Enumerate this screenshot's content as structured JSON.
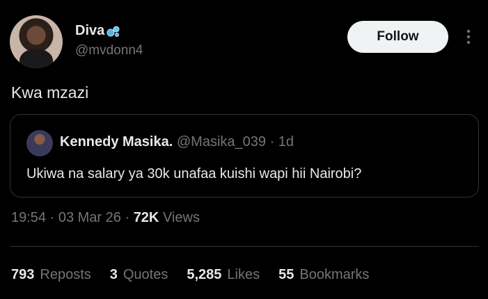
{
  "author": {
    "display_name": "Diva",
    "handle": "@mvdonn4"
  },
  "follow_label": "Follow",
  "tweet_text": "Kwa mzazi",
  "quoted": {
    "display_name": "Kennedy Masika.",
    "handle": "@Masika_039",
    "separator": " · ",
    "age": "1d",
    "text": "Ukiwa na salary ya 30k unafaa kuishi wapi hii Nairobi?"
  },
  "meta": {
    "time": "19:54",
    "date": "03 Mar 26",
    "views_count": "72K",
    "views_label": "Views"
  },
  "stats": {
    "reposts_count": "793",
    "reposts_label": "Reposts",
    "quotes_count": "3",
    "quotes_label": "Quotes",
    "likes_count": "5,285",
    "likes_label": "Likes",
    "bookmarks_count": "55",
    "bookmarks_label": "Bookmarks"
  },
  "icons": {
    "badge": "bubbles-icon",
    "more": "more-vertical-icon"
  },
  "colors": {
    "background": "#000000",
    "text": "#e7e9ea",
    "muted": "#71767b",
    "border": "#2f3336",
    "button": "#eff3f4",
    "bubbles": "#4fb3e8"
  }
}
